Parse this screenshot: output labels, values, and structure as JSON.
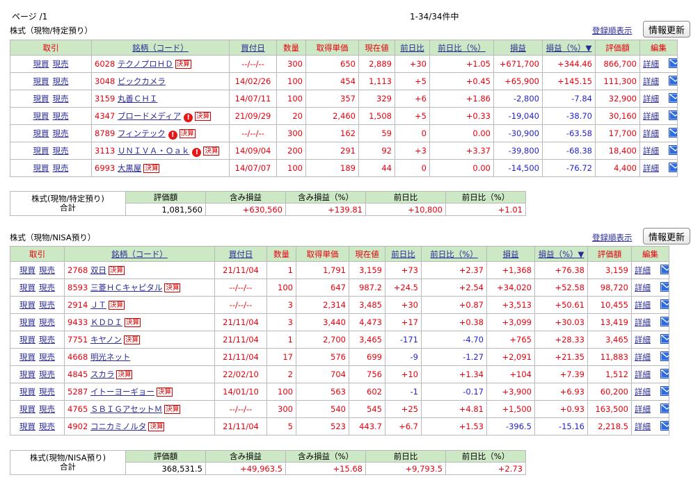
{
  "page_info": "ページ /1",
  "count_info": "1-34/34件中",
  "sections": [
    {
      "title": "株式（現物/特定預り）",
      "register_link": "登録順表示",
      "refresh_label": "情報更新",
      "headers": [
        "取引",
        "銘柄（コード）",
        "買付日",
        "数量",
        "取得単価",
        "現在値",
        "前日比",
        "前日比（%）",
        "損益",
        "損益（%）▼",
        "評価額",
        "編集"
      ],
      "rows": [
        {
          "buy": "現買",
          "sell": "現売",
          "code": "6028",
          "name": "テクノプロＨＤ",
          "warn": false,
          "badge": "決算",
          "date": "--/--/--",
          "qty": "300",
          "cost": "650",
          "price": "2,889",
          "chg": "+30",
          "chg_pct": "+1.05",
          "pl": "+671,700",
          "pl_pct": "+344.46",
          "value": "866,700",
          "detail": "詳細"
        },
        {
          "buy": "現買",
          "sell": "現売",
          "code": "3048",
          "name": "ビックカメラ",
          "warn": false,
          "badge": "",
          "date": "14/02/26",
          "qty": "100",
          "cost": "454",
          "price": "1,113",
          "chg": "+5",
          "chg_pct": "+0.45",
          "pl": "+65,900",
          "pl_pct": "+145.15",
          "value": "111,300",
          "detail": "詳細"
        },
        {
          "buy": "現買",
          "sell": "現売",
          "code": "3159",
          "name": "丸善ＣＨＩ",
          "warn": false,
          "badge": "",
          "date": "14/07/11",
          "qty": "100",
          "cost": "357",
          "price": "329",
          "chg": "+6",
          "chg_pct": "+1.86",
          "pl": "-2,800",
          "pl_pct": "-7.84",
          "value": "32,900",
          "detail": "詳細"
        },
        {
          "buy": "現買",
          "sell": "現売",
          "code": "4347",
          "name": "ブロードメディア",
          "warn": true,
          "badge": "決算",
          "date": "21/09/29",
          "qty": "20",
          "cost": "2,460",
          "price": "1,508",
          "chg": "+5",
          "chg_pct": "+0.33",
          "pl": "-19,040",
          "pl_pct": "-38.70",
          "value": "30,160",
          "detail": "詳細"
        },
        {
          "buy": "現買",
          "sell": "現売",
          "code": "8789",
          "name": "フィンテック",
          "warn": true,
          "badge": "決算",
          "date": "--/--/--",
          "qty": "300",
          "cost": "162",
          "price": "59",
          "chg": "0",
          "chg_pct": "0.00",
          "pl": "-30,900",
          "pl_pct": "-63.58",
          "value": "17,700",
          "detail": "詳細"
        },
        {
          "buy": "現買",
          "sell": "現売",
          "code": "3113",
          "name": "ＵＮＩＶＡ・Ｏａｋ",
          "warn": true,
          "badge": "決算",
          "date": "14/09/04",
          "qty": "200",
          "cost": "291",
          "price": "92",
          "chg": "+3",
          "chg_pct": "+3.37",
          "pl": "-39,800",
          "pl_pct": "-68.38",
          "value": "18,400",
          "detail": "詳細"
        },
        {
          "buy": "現買",
          "sell": "現売",
          "code": "6993",
          "name": "大黒屋",
          "warn": false,
          "badge": "決算",
          "date": "14/07/07",
          "qty": "100",
          "cost": "189",
          "price": "44",
          "chg": "0",
          "chg_pct": "0.00",
          "pl": "-14,500",
          "pl_pct": "-76.72",
          "value": "4,400",
          "detail": "詳細"
        }
      ],
      "summary": {
        "label1": "株式(現物/特定預り)",
        "label2": "合計",
        "headers": [
          "評価額",
          "含み損益",
          "含み損益（%）",
          "前日比",
          "前日比（%）"
        ],
        "values": [
          "1,081,560",
          "+630,560",
          "+139.81",
          "+10,800",
          "+1.01"
        ]
      }
    },
    {
      "title": "株式（現物/NISA預り）",
      "register_link": "登録順表示",
      "refresh_label": "情報更新",
      "headers": [
        "取引",
        "銘柄（コード）",
        "買付日",
        "数量",
        "取得単価",
        "現在値",
        "前日比",
        "前日比（%）",
        "損益",
        "損益（%）▼",
        "評価額",
        "編集"
      ],
      "rows": [
        {
          "buy": "現買",
          "sell": "現売",
          "code": "2768",
          "name": "双日",
          "warn": false,
          "badge": "決算",
          "date": "21/11/04",
          "qty": "1",
          "cost": "1,791",
          "price": "3,159",
          "chg": "+73",
          "chg_pct": "+2.37",
          "pl": "+1,368",
          "pl_pct": "+76.38",
          "value": "3,159",
          "detail": "詳細"
        },
        {
          "buy": "現買",
          "sell": "現売",
          "code": "8593",
          "name": "三菱ＨＣキャピタル",
          "warn": false,
          "badge": "決算",
          "date": "--/--/--",
          "qty": "100",
          "cost": "647",
          "price": "987.2",
          "chg": "+24.5",
          "chg_pct": "+2.54",
          "pl": "+34,020",
          "pl_pct": "+52.58",
          "value": "98,720",
          "detail": "詳細"
        },
        {
          "buy": "現買",
          "sell": "現売",
          "code": "2914",
          "name": "ＪＴ",
          "warn": false,
          "badge": "決算",
          "date": "--/--/--",
          "qty": "3",
          "cost": "2,314",
          "price": "3,485",
          "chg": "+30",
          "chg_pct": "+0.87",
          "pl": "+3,513",
          "pl_pct": "+50.61",
          "value": "10,455",
          "detail": "詳細"
        },
        {
          "buy": "現買",
          "sell": "現売",
          "code": "9433",
          "name": "ＫＤＤＩ",
          "warn": false,
          "badge": "決算",
          "date": "21/11/04",
          "qty": "3",
          "cost": "3,440",
          "price": "4,473",
          "chg": "+17",
          "chg_pct": "+0.38",
          "pl": "+3,099",
          "pl_pct": "+30.03",
          "value": "13,419",
          "detail": "詳細"
        },
        {
          "buy": "現買",
          "sell": "現売",
          "code": "7751",
          "name": "キヤノン",
          "warn": false,
          "badge": "決算",
          "date": "21/11/04",
          "qty": "1",
          "cost": "2,700",
          "price": "3,465",
          "chg": "-171",
          "chg_pct": "-4.70",
          "pl": "+765",
          "pl_pct": "+28.33",
          "value": "3,465",
          "detail": "詳細"
        },
        {
          "buy": "現買",
          "sell": "現売",
          "code": "4668",
          "name": "明光ネット",
          "warn": false,
          "badge": "",
          "date": "21/11/04",
          "qty": "17",
          "cost": "576",
          "price": "699",
          "chg": "-9",
          "chg_pct": "-1.27",
          "pl": "+2,091",
          "pl_pct": "+21.35",
          "value": "11,883",
          "detail": "詳細"
        },
        {
          "buy": "現買",
          "sell": "現売",
          "code": "4845",
          "name": "スカラ",
          "warn": false,
          "badge": "決算",
          "date": "22/02/10",
          "qty": "2",
          "cost": "704",
          "price": "756",
          "chg": "+10",
          "chg_pct": "+1.34",
          "pl": "+104",
          "pl_pct": "+7.39",
          "value": "1,512",
          "detail": "詳細"
        },
        {
          "buy": "現買",
          "sell": "現売",
          "code": "5287",
          "name": "イトーヨーギョー",
          "warn": false,
          "badge": "決算",
          "date": "14/01/10",
          "qty": "100",
          "cost": "563",
          "price": "602",
          "chg": "-1",
          "chg_pct": "-0.17",
          "pl": "+3,900",
          "pl_pct": "+6.93",
          "value": "60,200",
          "detail": "詳細"
        },
        {
          "buy": "現買",
          "sell": "現売",
          "code": "4765",
          "name": "ＳＢＩＧアセットＭ",
          "warn": false,
          "badge": "決算",
          "date": "--/--/--",
          "qty": "300",
          "cost": "540",
          "price": "545",
          "chg": "+25",
          "chg_pct": "+4.81",
          "pl": "+1,500",
          "pl_pct": "+0.93",
          "value": "163,500",
          "detail": "詳細"
        },
        {
          "buy": "現買",
          "sell": "現売",
          "code": "4902",
          "name": "コニカミノルタ",
          "warn": false,
          "badge": "決算",
          "date": "21/11/04",
          "qty": "5",
          "cost": "523",
          "price": "443.7",
          "chg": "+6.7",
          "chg_pct": "+1.53",
          "pl": "-396.5",
          "pl_pct": "-15.16",
          "value": "2,218.5",
          "detail": "詳細"
        }
      ],
      "summary": {
        "label1": "株式(現物/NISA預り)",
        "label2": "合計",
        "headers": [
          "評価額",
          "含み損益",
          "含み損益（%）",
          "前日比",
          "前日比（%）"
        ],
        "values": [
          "368,531.5",
          "+49,963.5",
          "+15.68",
          "+9,793.5",
          "+2.73"
        ]
      }
    }
  ]
}
